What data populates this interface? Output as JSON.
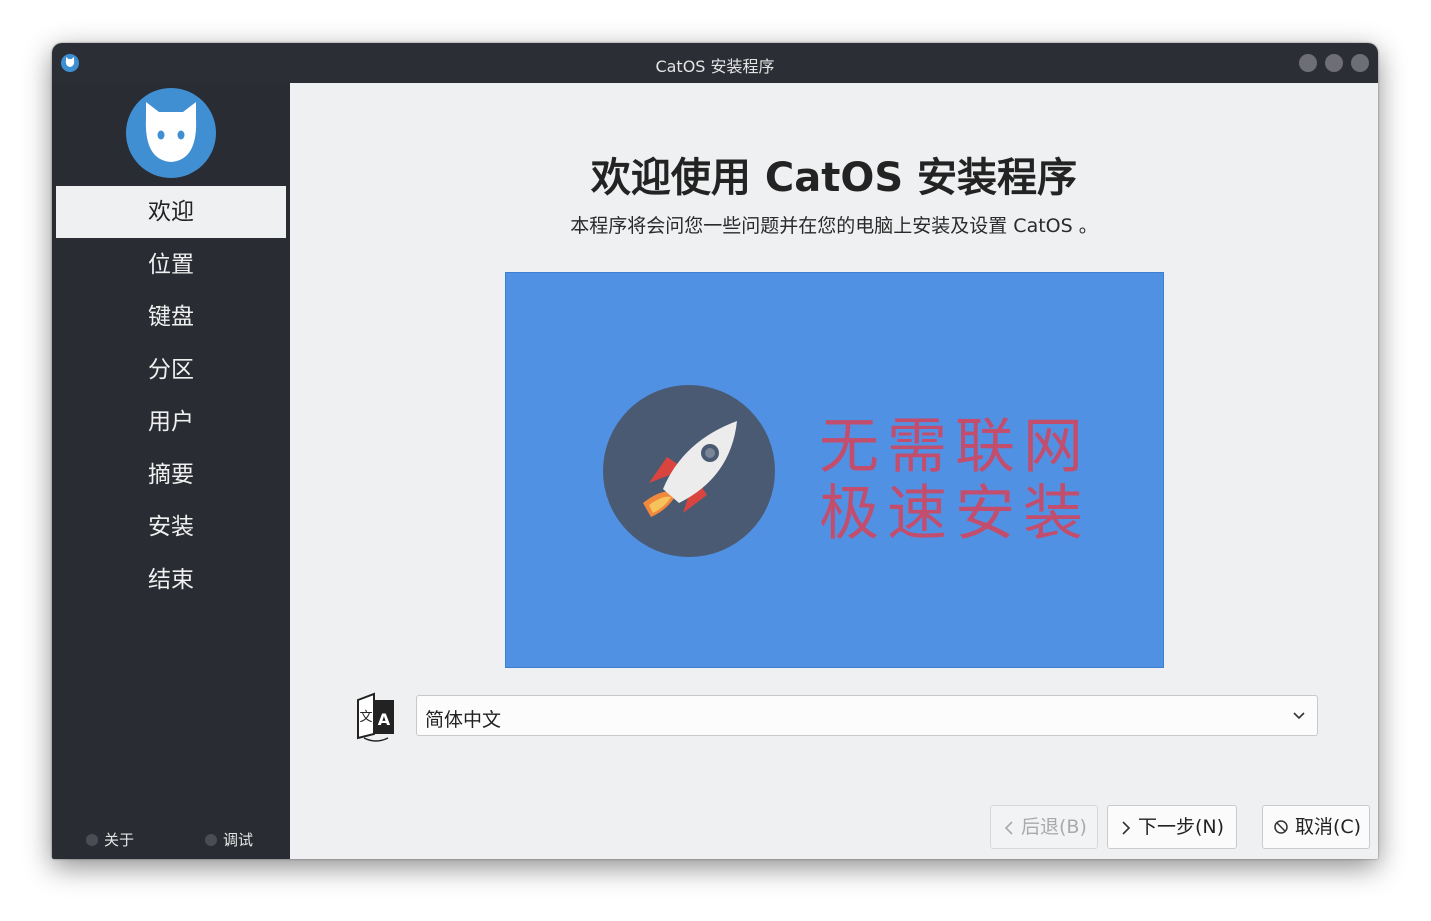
{
  "window": {
    "title": "CatOS 安装程序"
  },
  "sidebar": {
    "steps": [
      {
        "label": "欢迎",
        "active": true
      },
      {
        "label": "位置"
      },
      {
        "label": "键盘"
      },
      {
        "label": "分区"
      },
      {
        "label": "用户"
      },
      {
        "label": "摘要"
      },
      {
        "label": "安装"
      },
      {
        "label": "结束"
      }
    ],
    "footer": {
      "about_label": "关于",
      "debug_label": "调试"
    }
  },
  "main": {
    "heading": "欢迎使用 CatOS 安装程序",
    "subheading": "本程序将会问您一些问题并在您的电脑上安装及设置 CatOS 。",
    "banner": {
      "line1": "无需联网",
      "line2": "极速安装"
    },
    "language": {
      "selected": "简体中文"
    }
  },
  "buttons": {
    "back": "后退(B)",
    "next": "下一步(N)",
    "cancel": "取消(C)"
  },
  "colors": {
    "sidebar": "#292c33",
    "banner": "#5191e4",
    "accent_text": "#c34d6d"
  }
}
